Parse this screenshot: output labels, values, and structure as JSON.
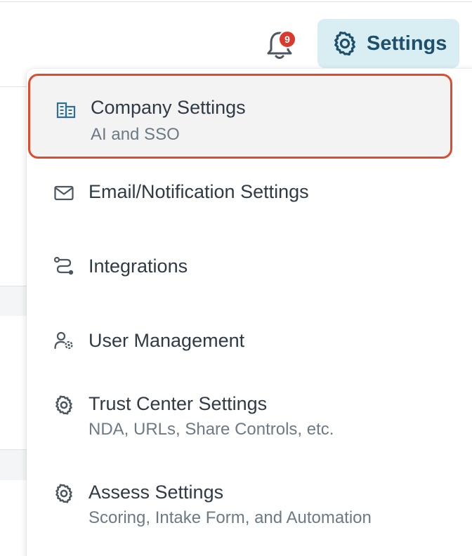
{
  "header": {
    "notification_count": "9",
    "settings_label": "Settings"
  },
  "menu": {
    "items": [
      {
        "title": "Company Settings",
        "subtitle": "AI and SSO",
        "icon": "building-icon"
      },
      {
        "title": "Email/Notification Settings",
        "icon": "mail-icon"
      },
      {
        "title": "Integrations",
        "icon": "route-icon"
      },
      {
        "title": "User Management",
        "icon": "user-gear-icon"
      },
      {
        "title": "Trust Center Settings",
        "subtitle": "NDA, URLs, Share Controls, etc.",
        "icon": "gear-icon"
      },
      {
        "title": "Assess Settings",
        "subtitle": "Scoring, Intake Form, and Automation",
        "icon": "gear-icon"
      }
    ]
  },
  "colors": {
    "accent": "#1e4f6b",
    "settings_button_bg": "#d9eef3",
    "badge": "#d93a2b",
    "highlight_border": "#e04a2f"
  }
}
